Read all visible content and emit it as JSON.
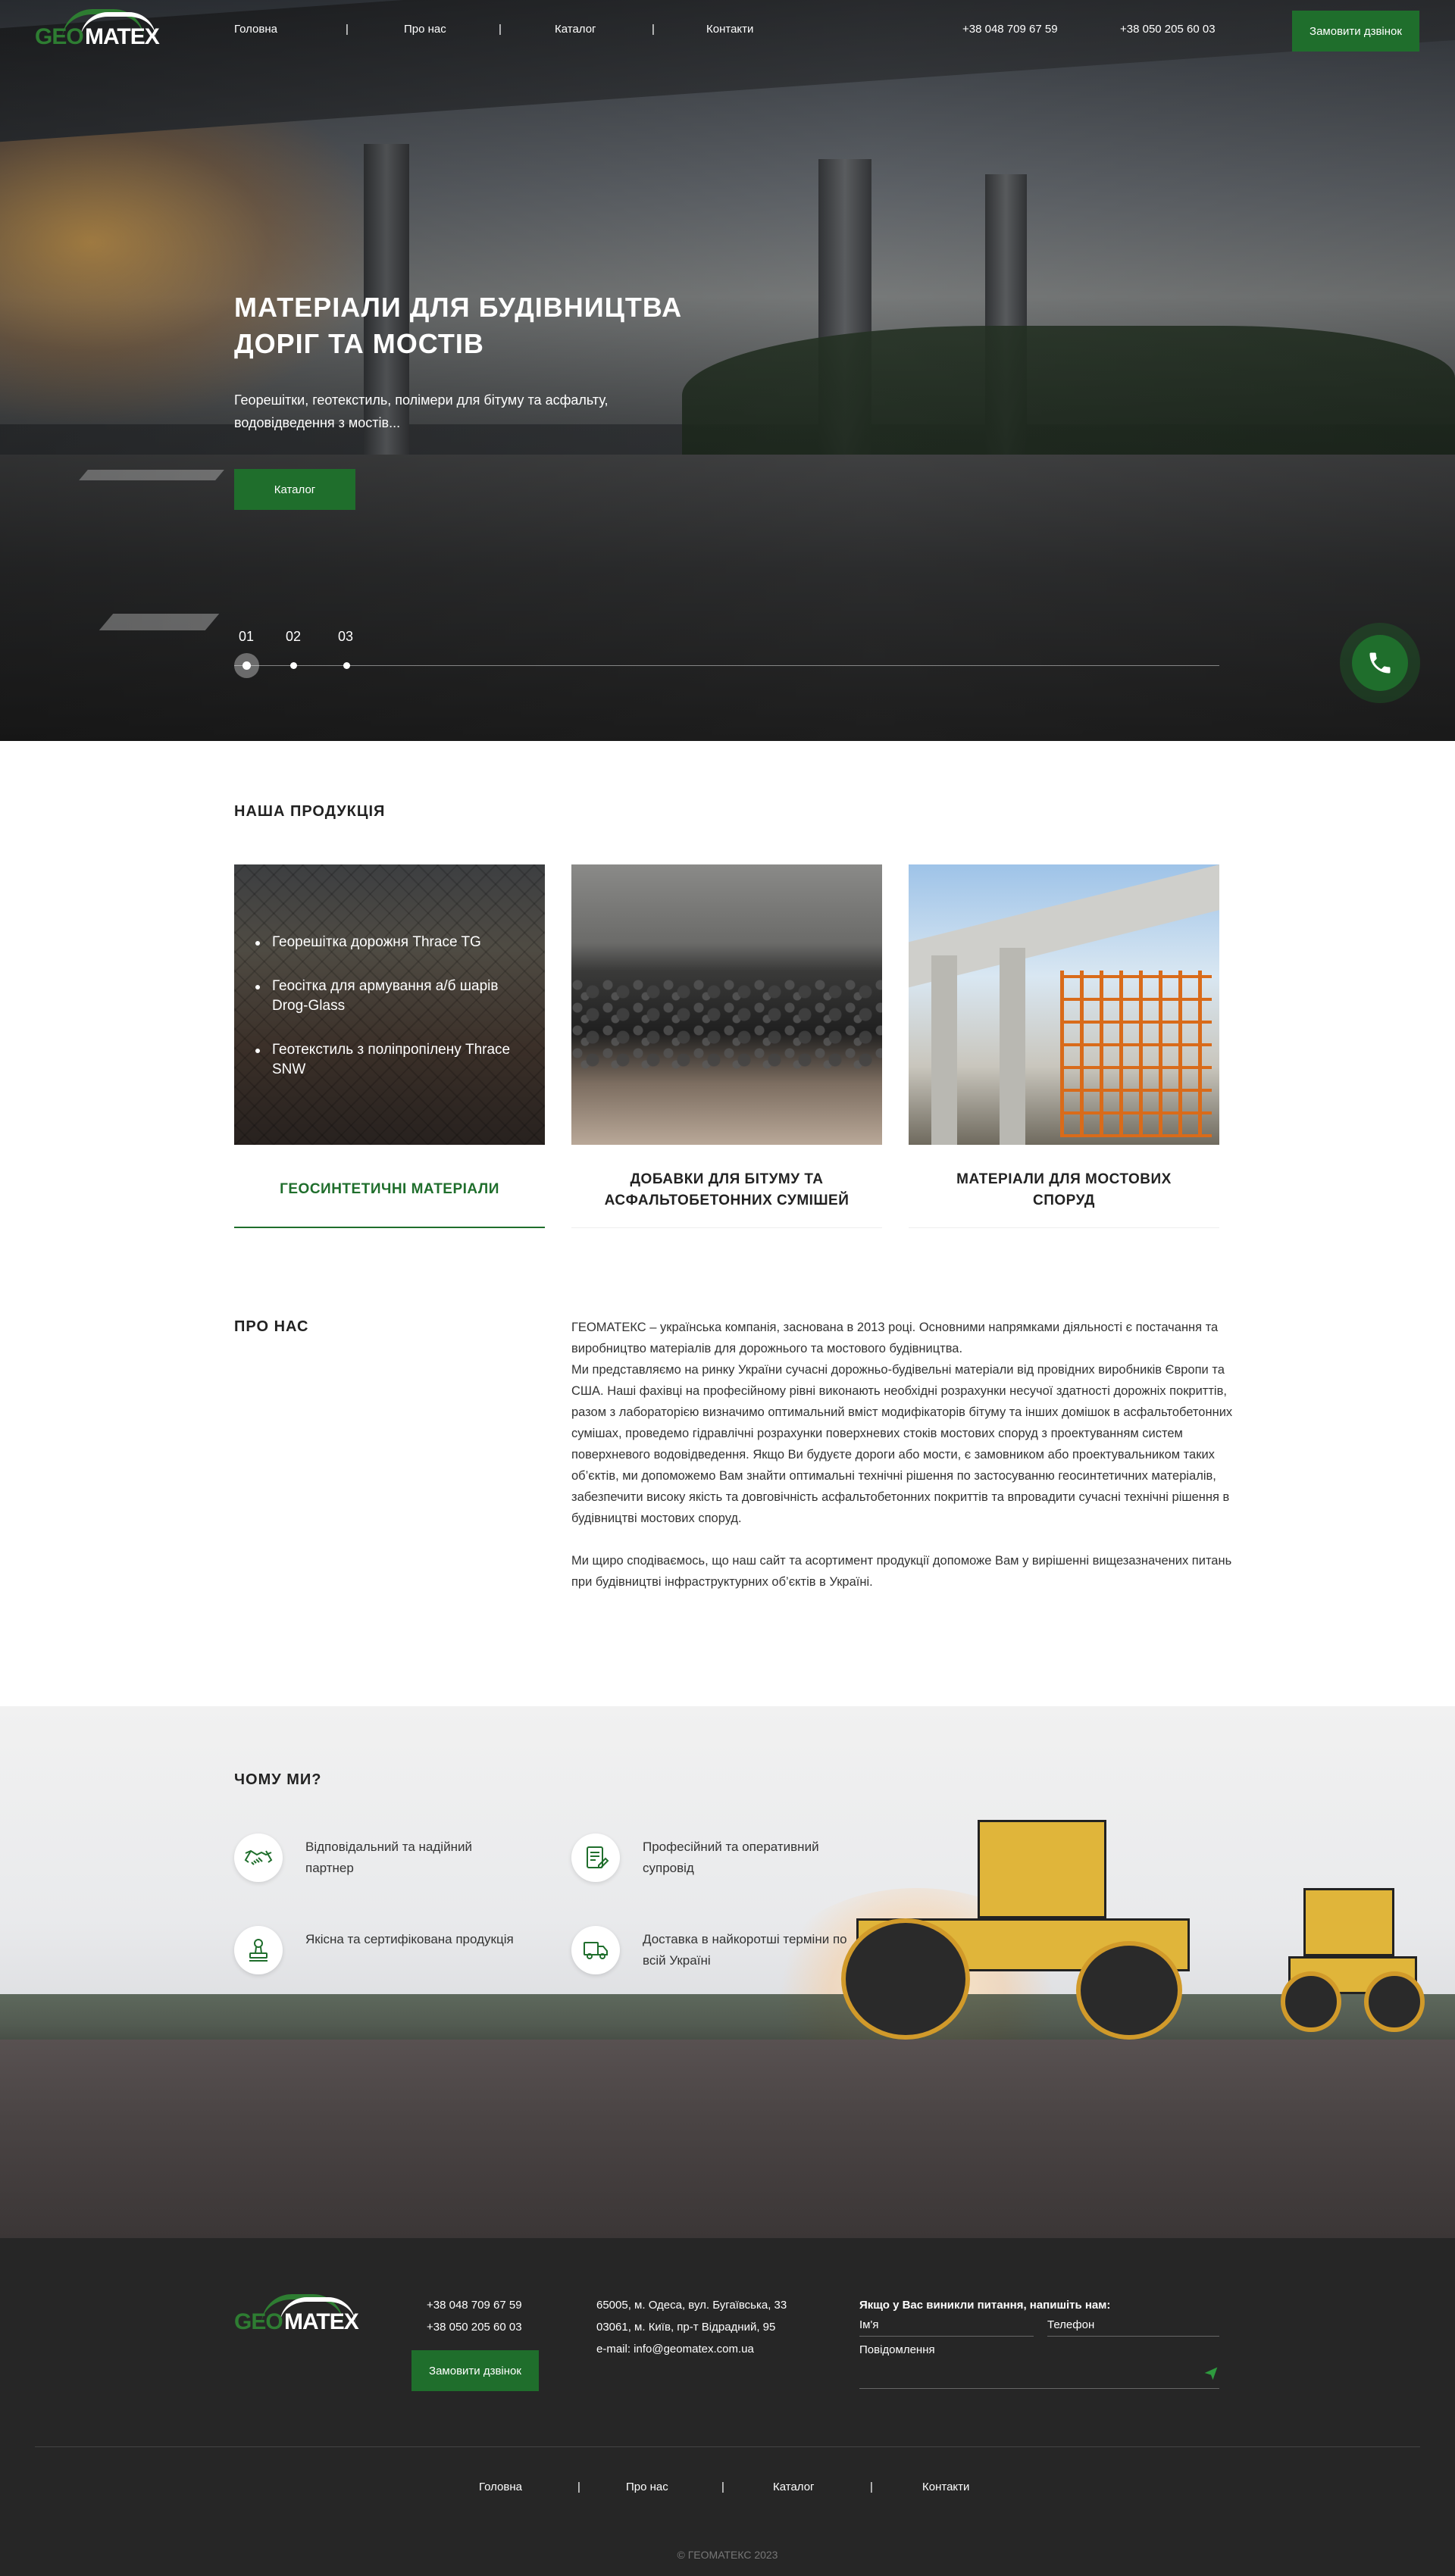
{
  "colors": {
    "brand_green": "#1f6e2c",
    "footer_bg": "#262626"
  },
  "logo": {
    "geo": "GEO",
    "matex": "MATEX"
  },
  "nav": {
    "items": [
      "Головна",
      "Про нас",
      "Каталог",
      "Контакти"
    ],
    "separator": "|"
  },
  "header": {
    "phones": [
      "+38 048 709 67 59",
      "+38 050 205 60 03"
    ],
    "callback_button": "Замовити дзвінок"
  },
  "hero": {
    "title_line1": "МАТЕРІАЛИ ДЛЯ БУДІВНИЦТВА",
    "title_line2": "ДОРІГ ТА МОСТІВ",
    "subtitle_line1": "Георешітки, геотекстиль, полімери для бітуму та асфальту,",
    "subtitle_line2": "водовідведення з мостів...",
    "cta": "Каталог",
    "slides": [
      "01",
      "02",
      "03"
    ],
    "active_slide": 1,
    "call_icon": "phone-icon"
  },
  "products": {
    "title": "НАША ПРОДУКЦІЯ",
    "cards": [
      {
        "label": "ГЕОСИНТЕТИЧНІ МАТЕРІАЛИ",
        "active": true,
        "bullets": [
          "Георешітка дорожня Thrace TG",
          "Геосітка для армування а/б шарів Drog-Glass",
          "Геотекстиль з поліпропілену Thrace SNW"
        ]
      },
      {
        "label_line1": "ДОБАВКИ ДЛЯ БІТУМУ ТА",
        "label_line2": "АСФАЛЬТОБЕТОННИХ СУМІШЕЙ",
        "active": false
      },
      {
        "label_line1": "МАТЕРІАЛИ ДЛЯ МОСТОВИХ",
        "label_line2": "СПОРУД",
        "active": false
      }
    ]
  },
  "about": {
    "title": "ПРО НАС",
    "p1": "ГЕОМАТЕКС – українська компанія, заснована в 2013 році. Основними напрямками діяльності є постачання та виробництво матеріалів для дорожнього та мостового будівництва.",
    "p2": "Ми представляємо на ринку України сучасні дорожньо-будівельні матеріали від провідних виробників Європи та США.  Наші фахівці на професійному рівні виконають необхідні розрахунки несучої здатності дорожніх покриттів, разом з лабораторією визначимо оптимальний вміст модифікаторів бітуму та інших домішок в асфальтобетонних сумішах, проведемо гідравлічні розрахунки поверхневих стоків мостових споруд з проектуванням систем поверхневого водовідведення. Якщо Ви будуєте дороги або мости, є замовником або проектувальником таких об’єктів, ми допоможемо Вам знайти оптимальні технічні рішення по застосуванню геосинтетичних матеріалів, забезпечити високу якість та довговічність асфальтобетонних покриттів та впровадити сучасні технічні рішення в будівництві мостових споруд.",
    "p3": "Ми щиро сподіваємось, що наш сайт та асортимент продукції допоможе Вам у вирішенні вищезазначених питань при будівництві інфраструктурних об’єктів в Україні."
  },
  "why": {
    "title": "ЧОМУ МИ?",
    "features": [
      {
        "icon": "handshake-icon",
        "text": "Відповідальний та надійний партнер"
      },
      {
        "icon": "document-edit-icon",
        "text": "Професійний та оперативний супровід"
      },
      {
        "icon": "stamp-icon",
        "text": "Якісна та сертифікована продукція"
      },
      {
        "icon": "truck-icon",
        "text": "Доставка в найкоротші терміни по всій Україні"
      }
    ]
  },
  "footer": {
    "phones": [
      "+38 048 709 67 59",
      "+38 050 205 60 03"
    ],
    "callback_button": "Замовити дзвінок",
    "address1": "65005, м. Одеса, вул. Бугаївська, 33",
    "address2": "03061, м. Київ, пр-т  Відрадний, 95",
    "email": "e-mail: info@geomatex.com.ua",
    "form_title": "Якщо у Вас виникли питання, напишіть нам:",
    "name_placeholder": "Ім'я",
    "phone_placeholder": "Телефон",
    "message_placeholder": "Повідомлення",
    "send_icon": "send-icon",
    "copyright": "© ГЕОМАТЕКС 2023"
  }
}
